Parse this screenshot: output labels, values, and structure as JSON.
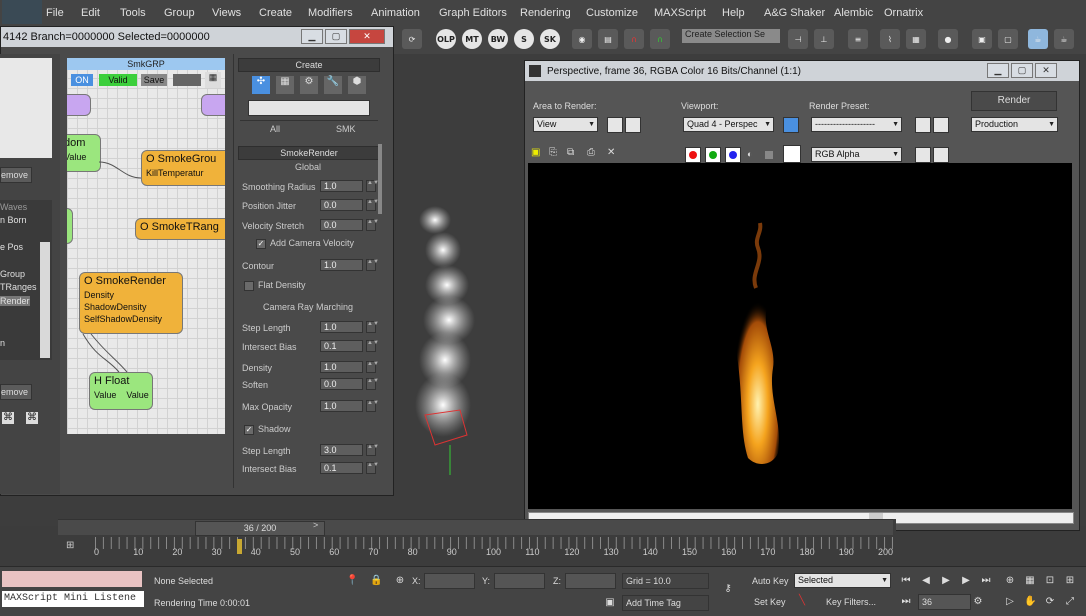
{
  "menubar": {
    "items": [
      "File",
      "Edit",
      "Tools",
      "Group",
      "Views",
      "Create",
      "Modifiers",
      "Animation",
      "Graph Editors",
      "Rendering",
      "Customize",
      "MAXScript",
      "Help",
      "A&G Shaker",
      "Alembic",
      "Ornatrix"
    ]
  },
  "toolbar": {
    "selection_set": "Create Selection Se",
    "round_buttons": [
      "OLP",
      "MT",
      "BW",
      "SK"
    ]
  },
  "smk_window": {
    "title": "4142  Branch=0000000  Selected=0000000",
    "graph_header": "SmkGRP",
    "buttons": {
      "on": "ON",
      "valid": "Valid",
      "save": "Save"
    },
    "left_list": {
      "remove1": "emove",
      "items": [
        "Waves",
        "n Born",
        "e Pos",
        "Group",
        "TRanges",
        "Render",
        "n"
      ],
      "remove2": "emove"
    },
    "nodes": {
      "dom": {
        "title": "dom",
        "ports": [
          "Value"
        ]
      },
      "smoke_group": {
        "title": "O SmokeGrou",
        "ports": [
          "KillTemperatur"
        ]
      },
      "smoke_trange": {
        "title": "O SmokeTRang"
      },
      "smoke_render": {
        "title": "O SmokeRender",
        "ports": [
          "Density",
          "ShadowDensity",
          "SelfShadowDensity"
        ]
      },
      "float": {
        "title": "H Float",
        "ports": [
          "Value",
          "Value"
        ]
      }
    }
  },
  "create_panel": {
    "header": "Create",
    "tabs": [
      "All",
      "SMK"
    ],
    "smokerender_header": "SmokeRender",
    "global": "Global",
    "params": [
      {
        "label": "Smoothing Radius",
        "value": "1.0"
      },
      {
        "label": "Position Jitter",
        "value": "0.0"
      },
      {
        "label": "Velocity Stretch",
        "value": "0.0"
      }
    ],
    "add_camera_velocity": "Add Camera Velocity",
    "contour": {
      "label": "Contour",
      "value": "1.0"
    },
    "flat_density": "Flat Density",
    "camera_ray_marching": "Camera Ray Marching",
    "params2": [
      {
        "label": "Step Length",
        "value": "1.0"
      },
      {
        "label": "Intersect Bias",
        "value": "0.1"
      },
      {
        "label": "Density",
        "value": "1.0"
      },
      {
        "label": "Soften",
        "value": "0.0"
      },
      {
        "label": "Max Opacity",
        "value": "1.0"
      }
    ],
    "shadow": "Shadow",
    "params3": [
      {
        "label": "Step Length",
        "value": "3.0"
      },
      {
        "label": "Intersect Bias",
        "value": "0.1"
      }
    ]
  },
  "render_window": {
    "title": "Perspective, frame 36, RGBA Color 16 Bits/Channel (1:1)",
    "area_to_render_label": "Area to Render:",
    "area_to_render": "View",
    "viewport_label": "Viewport:",
    "viewport": "Quad 4 - Perspec",
    "render_preset_label": "Render Preset:",
    "render_preset": "--------------------",
    "render_button": "Render",
    "production": "Production",
    "channel": "RGB Alpha"
  },
  "timeline": {
    "frame_display": "36 / 200",
    "ticks": [
      "0",
      "10",
      "20",
      "30",
      "40",
      "50",
      "60",
      "70",
      "80",
      "90",
      "100",
      "110",
      "120",
      "130",
      "140",
      "150",
      "160",
      "170",
      "180",
      "190",
      "200"
    ],
    "current_frame": 36,
    "total_frames": 200
  },
  "statusbar": {
    "maxscript": "MAXScript Mini Listene",
    "selection": "None Selected",
    "render_time": "Rendering Time  0:00:01",
    "x_label": "X:",
    "y_label": "Y:",
    "z_label": "Z:",
    "grid": "Grid = 10.0",
    "add_time_tag": "Add Time Tag",
    "auto_key": "Auto Key",
    "selected": "Selected",
    "set_key": "Set Key",
    "key_filters": "Key Filters...",
    "frame": "36"
  },
  "colors": {
    "accent_blue": "#9dc8f0",
    "node_green": "#9be67e",
    "node_orange": "#f0b23a",
    "node_purple": "#c8a6f0",
    "valid_green": "#3ccf3c"
  }
}
